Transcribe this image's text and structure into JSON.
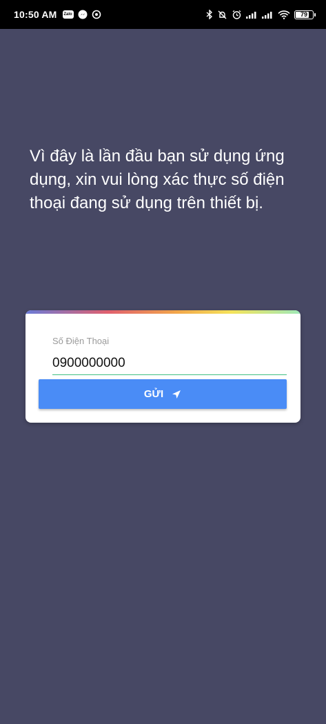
{
  "status_bar": {
    "time": "10:50 AM",
    "zalo_label": "Zalo",
    "battery": "79",
    "battery_level": 0.79,
    "icons": [
      "zalo-icon",
      "messenger-icon",
      "location-icon",
      "bluetooth-icon",
      "do-not-disturb-icon",
      "alarm-icon",
      "signal-icon",
      "signal-icon",
      "wifi-icon",
      "battery-icon"
    ]
  },
  "main": {
    "message": "Vì đây là lần đầu bạn sử dụng ứng dụng, xin vui lòng xác thực số điện thoại đang sử dụng trên thiết bị."
  },
  "form": {
    "phone_label": "Số Điện Thoại",
    "phone_value": "0900000000",
    "send_label": "GỬI"
  },
  "colors": {
    "background": "#474864",
    "button": "#4a8cf6",
    "input_underline": "#3fbf82"
  }
}
